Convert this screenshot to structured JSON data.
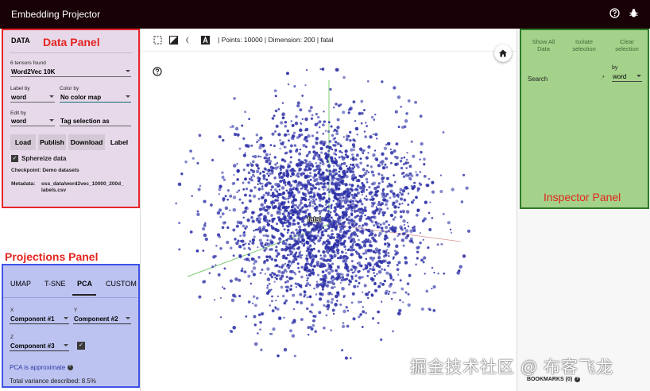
{
  "app": {
    "title": "Embedding Projector"
  },
  "data_panel": {
    "tab": "DATA",
    "annotation": "Data Panel",
    "tensors_found": "6 tensors found",
    "tensor": "Word2Vec 10K",
    "label_by": {
      "label": "Label by",
      "value": "word"
    },
    "color_by": {
      "label": "Color by",
      "value": "No color map"
    },
    "edit_by": {
      "label": "Edit by",
      "value": "word"
    },
    "tag_selection": "Tag selection as",
    "buttons": {
      "load": "Load",
      "publish": "Publish",
      "download": "Download",
      "label": "Label"
    },
    "sphereize": "Sphereize data",
    "checkpoint": "Checkpoint: Demo datasets",
    "metadata_label": "Metadata:",
    "metadata_line1": "oss_data/word2vec_10000_200d_",
    "metadata_line2": "labels.csv"
  },
  "projections_panel": {
    "annotation": "Projections Panel",
    "tabs": [
      "UMAP",
      "T-SNE",
      "PCA",
      "CUSTOM"
    ],
    "x": {
      "label": "X",
      "value": "Component #1"
    },
    "y": {
      "label": "Y",
      "value": "Component #2"
    },
    "z": {
      "label": "Z",
      "value": "Component #3"
    },
    "approx": "PCA is approximate",
    "variance": "Total variance described: 8.5%"
  },
  "toolbar": {
    "status": "| Points: 10000 | Dimension: 200 | fatal"
  },
  "scatter": {
    "center_label": "fatal",
    "point_color": "#2b2fa6"
  },
  "inspector": {
    "annotation": "Inspector Panel",
    "show_all": [
      "Show All",
      "Data"
    ],
    "isolate": [
      "Isolate",
      "selection"
    ],
    "clear": [
      "Clear",
      "selection"
    ],
    "search": "Search",
    "by_label": "by",
    "by_value": "word"
  },
  "bookmarks": "BOOKMARKS (0)",
  "watermark": "掘金技术社区 @ 布客飞龙",
  "colors": {
    "data_panel_border": "#e8252a",
    "projections_border": "#3f53e8",
    "inspector_bg": "#a4d28a"
  }
}
